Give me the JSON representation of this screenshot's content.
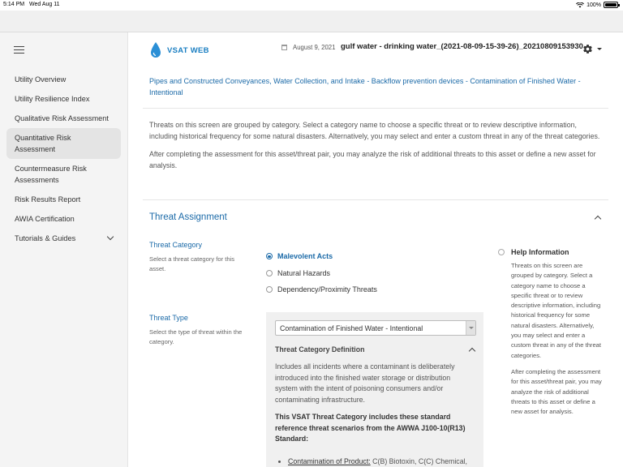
{
  "status_bar": {
    "time": "5:14 PM",
    "date": "Wed Aug 11",
    "battery": "100%"
  },
  "sidebar": {
    "items": [
      {
        "label": "Utility Overview",
        "active": false
      },
      {
        "label": "Utility Resilience Index",
        "active": false
      },
      {
        "label": "Qualitative Risk Assessment",
        "active": false
      },
      {
        "label": "Quantitative Risk Assessment",
        "active": true
      },
      {
        "label": "Countermeasure Risk Assessments",
        "active": false
      },
      {
        "label": "Risk Results Report",
        "active": false
      },
      {
        "label": "AWIA Certification",
        "active": false
      },
      {
        "label": "Tutorials & Guides",
        "active": false
      }
    ]
  },
  "header": {
    "logo_text": "VSAT WEB",
    "date": "August 9, 2021",
    "asset_title": "gulf water - drinking water_(2021-08-09-15-39-26)_20210809153930"
  },
  "breadcrumb": "Pipes and Constructed Conveyances, Water Collection, and Intake - Backflow prevention devices - Contamination of Finished Water - Intentional",
  "intro": {
    "p1": "Threats on this screen are grouped by category. Select a category name to choose a specific threat or to review descriptive information, including historical frequency for some natural disasters. Alternatively, you may select and enter a custom threat in any of the threat categories.",
    "p2": "After completing the assessment for this asset/threat pair, you may analyze the risk of additional threats to this asset or define a new asset for analysis."
  },
  "threat_assignment": {
    "title": "Threat Assignment",
    "category_label": "Threat Category",
    "category_help": "Select a threat category for this asset.",
    "categories": [
      {
        "label": "Malevolent Acts",
        "selected": true
      },
      {
        "label": "Natural Hazards",
        "selected": false
      },
      {
        "label": "Dependency/Proximity Threats",
        "selected": false
      }
    ],
    "type_label": "Threat Type",
    "type_help": "Select the type of threat within the category.",
    "selected_type": "Contamination of Finished Water - Intentional",
    "definition_title": "Threat Category Definition",
    "definition_p1": "Includes all incidents where a contaminant is deliberately introduced into the finished water storage or distribution system with the intent of poisoning consumers and/or contaminating infrastructure.",
    "definition_p2": "This VSAT Threat Category includes these standard reference threat scenarios from the AWWA J100-10(R13) Standard:",
    "scenario_term": "Contamination of Product:",
    "scenario_text": " C(B) Biotoxin, C(C) Chemical,"
  },
  "help_info": {
    "title": "Help Information",
    "p1": "Threats on this screen are grouped by category. Select a category name to choose a specific threat or to review descriptive information, including historical frequency for some natural disasters. Alternatively, you may select and enter a custom threat in any of the threat categories.",
    "p2": "After completing the assessment for this asset/threat pair, you may analyze the risk of additional threats to this asset or define a new asset for analysis."
  },
  "colors": {
    "accent": "#1b6aa8",
    "logo": "#1b7fc2",
    "sidebar_bg": "#f4f4f4",
    "panel_bg": "#f0f0f0"
  }
}
